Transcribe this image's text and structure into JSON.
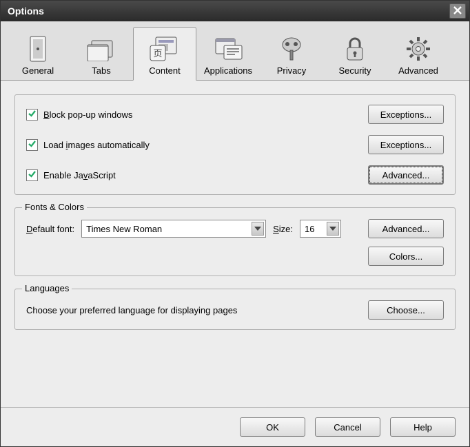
{
  "window": {
    "title": "Options"
  },
  "tabs": {
    "general": {
      "label": "General"
    },
    "tabs_tab": {
      "label": "Tabs"
    },
    "content": {
      "label": "Content"
    },
    "applications": {
      "label": "Applications"
    },
    "privacy": {
      "label": "Privacy"
    },
    "security": {
      "label": "Security"
    },
    "advanced": {
      "label": "Advanced"
    },
    "active": "content"
  },
  "content_panel": {
    "block_popups": {
      "label_pre": "",
      "label_u": "B",
      "label_post": "lock pop-up windows",
      "checked": true,
      "button": {
        "pre": "E",
        "u": "x",
        "post": "ceptions..."
      }
    },
    "load_images": {
      "label_pre": "Load ",
      "label_u": "i",
      "label_post": "mages automatically",
      "checked": true,
      "button": {
        "pre": "Ex",
        "u": "c",
        "post": "eptions..."
      }
    },
    "enable_js": {
      "label_pre": "Enable Ja",
      "label_u": "v",
      "label_post": "aScript",
      "checked": true,
      "button": {
        "pre": "Ad",
        "u": "v",
        "post": "anced..."
      }
    }
  },
  "fonts_colors": {
    "legend": "Fonts & Colors",
    "default_font_label": {
      "pre": "",
      "u": "D",
      "post": "efault font:"
    },
    "default_font_value": "Times New Roman",
    "size_label": {
      "pre": "",
      "u": "S",
      "post": "ize:"
    },
    "size_value": "16",
    "advanced_btn": {
      "pre": "",
      "u": "A",
      "post": "dvanced..."
    },
    "colors_btn": {
      "pre": "",
      "u": "C",
      "post": "olors..."
    }
  },
  "languages": {
    "legend": "Languages",
    "desc": "Choose your preferred language for displaying pages",
    "choose_btn": {
      "pre": "Ch",
      "u": "o",
      "post": "ose..."
    }
  },
  "footer": {
    "ok": "OK",
    "cancel": "Cancel",
    "help": "Help"
  }
}
